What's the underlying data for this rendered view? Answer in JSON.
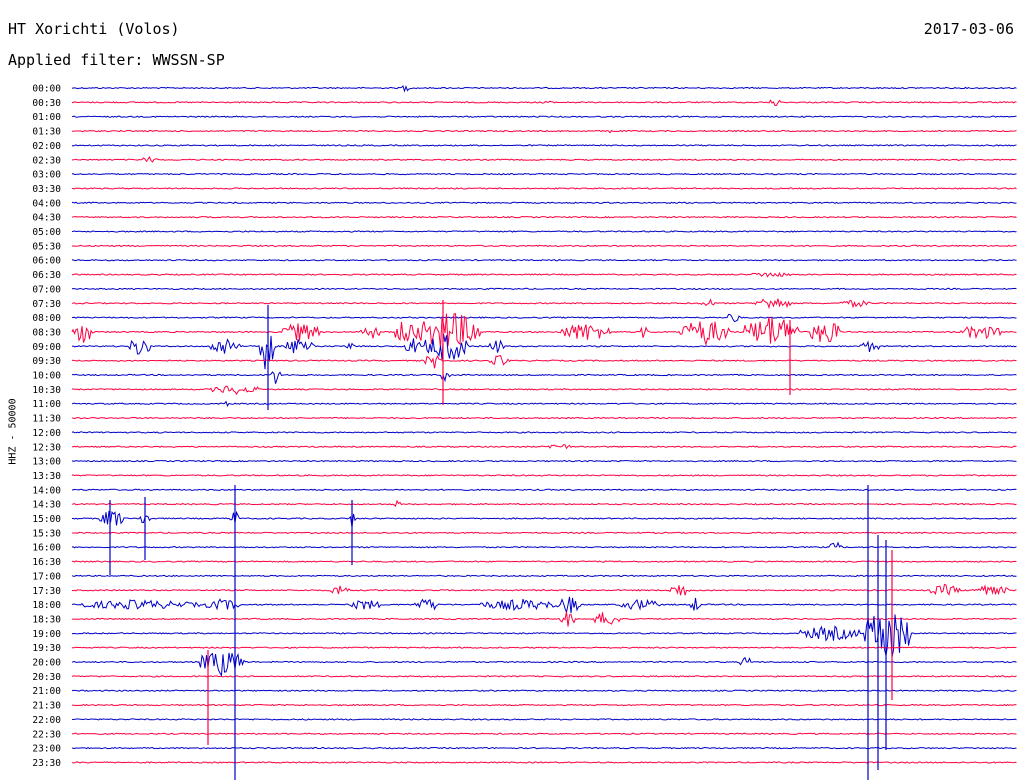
{
  "header": {
    "station": "HT Xorichti (Volos)",
    "date": "2017-03-06",
    "filter": "Applied filter: WWSSN-SP"
  },
  "chart_data": {
    "type": "line",
    "title": "HT Xorichti (Volos)",
    "date": "2017-03-06",
    "filter": "Applied filter: WWSSN-SP",
    "ylabel": "HHZ - 50000",
    "colors": [
      "#0000c8",
      "#ff0040"
    ],
    "rows": [
      "00:00",
      "00:30",
      "01:00",
      "01:30",
      "02:00",
      "02:30",
      "03:00",
      "03:30",
      "04:00",
      "04:30",
      "05:00",
      "05:30",
      "06:00",
      "06:30",
      "07:00",
      "07:30",
      "08:00",
      "08:30",
      "09:00",
      "09:30",
      "10:00",
      "10:30",
      "11:00",
      "11:30",
      "12:00",
      "12:30",
      "13:00",
      "13:30",
      "14:00",
      "14:30",
      "15:00",
      "15:30",
      "16:00",
      "16:30",
      "17:00",
      "17:30",
      "18:00",
      "18:30",
      "19:00",
      "19:30",
      "20:00",
      "20:30",
      "21:00",
      "21:30",
      "22:00",
      "22:30",
      "23:00",
      "23:30"
    ]
  }
}
